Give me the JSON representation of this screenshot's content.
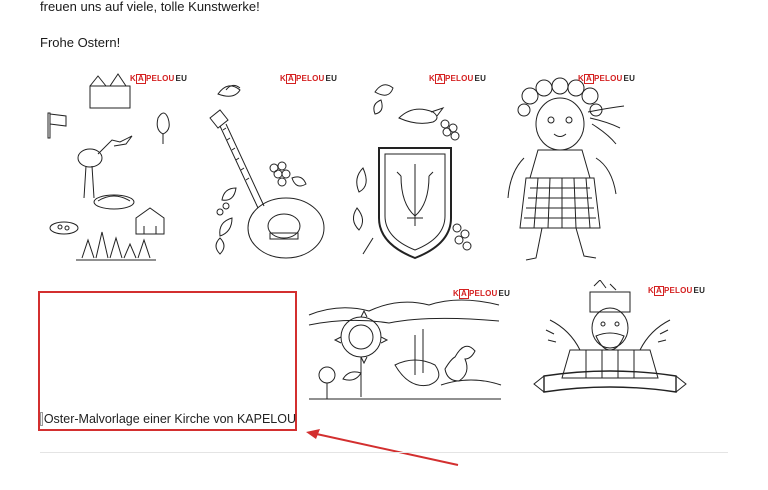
{
  "intro": {
    "line1": "freuen uns auf viele, tolle Kunstwerke!",
    "line2": "Frohe Ostern!"
  },
  "logo": {
    "ka": "K",
    "a": "A",
    "rest": "PELOU",
    "eu": "EU"
  },
  "broken_image": {
    "alt": "Oster-Malvorlage einer Kirche von KAPELOU"
  },
  "colors": {
    "highlight": "#d32f2f",
    "brand_red": "#d42020"
  },
  "thumbnails": [
    {
      "icon": "stork-and-church-coloring-icon"
    },
    {
      "icon": "bandura-instrument-coloring-icon"
    },
    {
      "icon": "trident-coat-of-arms-coloring-icon"
    },
    {
      "icon": "girl-in-wreath-coloring-icon"
    },
    {
      "icon": "sunflower-landscape-coloring-icon"
    },
    {
      "icon": "cossack-banner-coloring-icon"
    }
  ]
}
